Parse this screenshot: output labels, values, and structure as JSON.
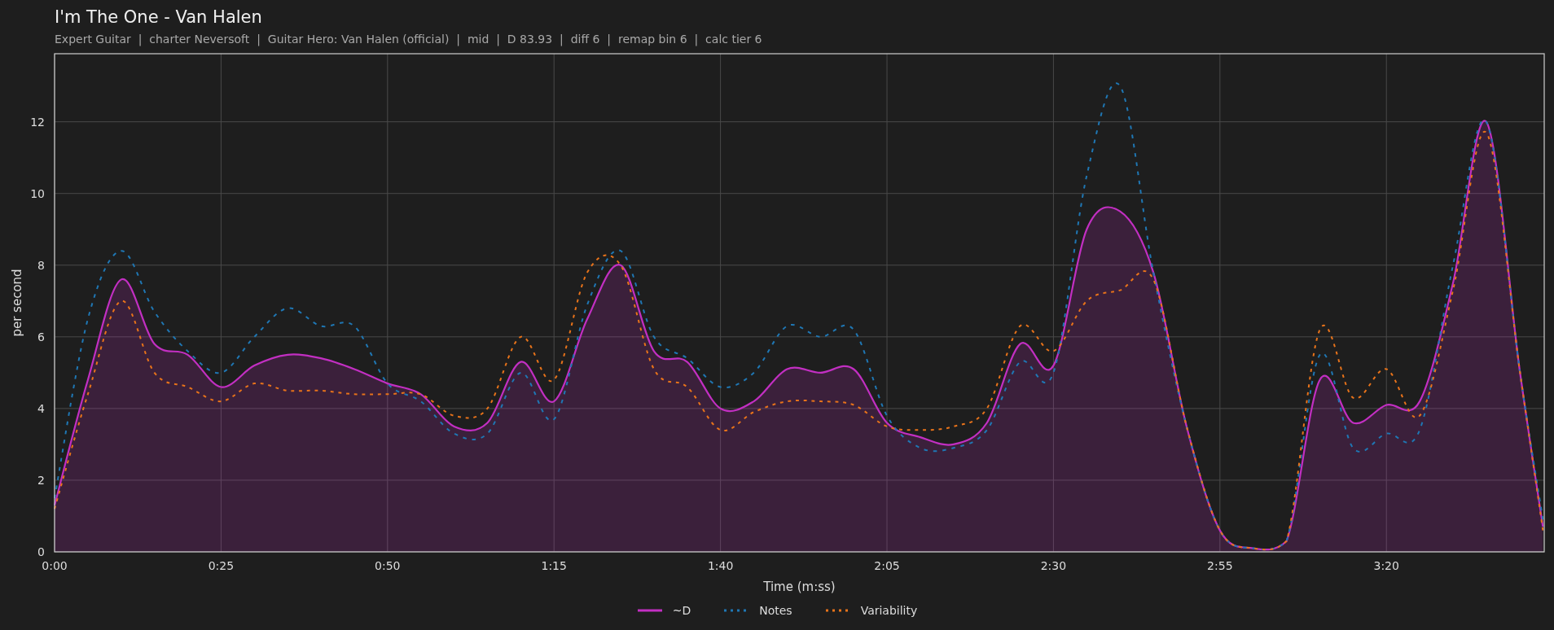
{
  "title": "I'm The One - Van Halen",
  "subtitle": "Expert Guitar  |  charter Neversoft  |  Guitar Hero: Van Halen (official)  |  mid  |  D 83.93  |  diff 6  |  remap bin 6  |  calc tier 6",
  "chart_data": {
    "type": "line",
    "xlabel": "Time (m:ss)",
    "ylabel": "per second",
    "x": [
      0,
      5,
      10,
      15,
      20,
      25,
      30,
      35,
      40,
      45,
      50,
      55,
      60,
      65,
      70,
      75,
      80,
      85,
      90,
      95,
      100,
      105,
      110,
      115,
      120,
      125,
      130,
      135,
      140,
      145,
      150,
      155,
      160,
      165,
      170,
      175,
      180,
      185,
      190,
      195,
      200,
      205,
      210,
      215,
      220,
      223.5
    ],
    "series": [
      {
        "name": "~D",
        "color": "#c22fc2",
        "type": "area",
        "line_style": "solid",
        "values": [
          1.3,
          4.8,
          7.6,
          5.8,
          5.5,
          4.6,
          5.2,
          5.5,
          5.4,
          5.1,
          4.7,
          4.4,
          3.5,
          3.6,
          5.3,
          4.2,
          6.5,
          8.0,
          5.6,
          5.3,
          4.0,
          4.2,
          5.1,
          5.0,
          5.1,
          3.6,
          3.2,
          3.0,
          3.6,
          5.8,
          5.2,
          9.0,
          9.5,
          7.8,
          3.5,
          0.6,
          0.1,
          0.3,
          4.8,
          3.6,
          4.1,
          4.2,
          7.5,
          12.0,
          5.1,
          0.7
        ]
      },
      {
        "name": "Notes",
        "color": "#1f77b4",
        "type": "line",
        "line_style": "dotted",
        "values": [
          1.5,
          6.5,
          8.4,
          6.7,
          5.6,
          5.0,
          6.0,
          6.8,
          6.3,
          6.3,
          4.7,
          4.2,
          3.3,
          3.3,
          5.0,
          3.7,
          6.9,
          8.4,
          6.0,
          5.4,
          4.6,
          5.0,
          6.3,
          6.0,
          6.2,
          3.8,
          2.9,
          2.9,
          3.4,
          5.3,
          5.0,
          10.5,
          13.0,
          7.8,
          3.5,
          0.6,
          0.1,
          0.3,
          5.5,
          2.9,
          3.3,
          3.4,
          8.0,
          12.0,
          5.1,
          0.9
        ]
      },
      {
        "name": "Variability",
        "color": "#e8731a",
        "type": "line",
        "line_style": "dotted",
        "values": [
          1.2,
          4.4,
          7.0,
          5.0,
          4.6,
          4.2,
          4.7,
          4.5,
          4.5,
          4.4,
          4.4,
          4.4,
          3.8,
          4.0,
          6.0,
          4.8,
          7.8,
          8.0,
          5.1,
          4.6,
          3.4,
          3.9,
          4.2,
          4.2,
          4.1,
          3.5,
          3.4,
          3.5,
          4.0,
          6.3,
          5.6,
          7.0,
          7.3,
          7.6,
          3.5,
          0.6,
          0.1,
          0.3,
          6.2,
          4.3,
          5.1,
          3.8,
          7.3,
          11.7,
          5.1,
          0.6
        ]
      }
    ],
    "grid": true,
    "xlim": [
      0,
      223.7
    ],
    "ylim": [
      0,
      13.9
    ],
    "xticks": [
      {
        "value": 0,
        "label": "0:00"
      },
      {
        "value": 25,
        "label": "0:25"
      },
      {
        "value": 50,
        "label": "0:50"
      },
      {
        "value": 75,
        "label": "1:15"
      },
      {
        "value": 100,
        "label": "1:40"
      },
      {
        "value": 125,
        "label": "2:05"
      },
      {
        "value": 150,
        "label": "2:30"
      },
      {
        "value": 175,
        "label": "2:55"
      },
      {
        "value": 200,
        "label": "3:20"
      }
    ],
    "yticks": [
      0,
      2,
      4,
      6,
      8,
      10,
      12
    ]
  }
}
